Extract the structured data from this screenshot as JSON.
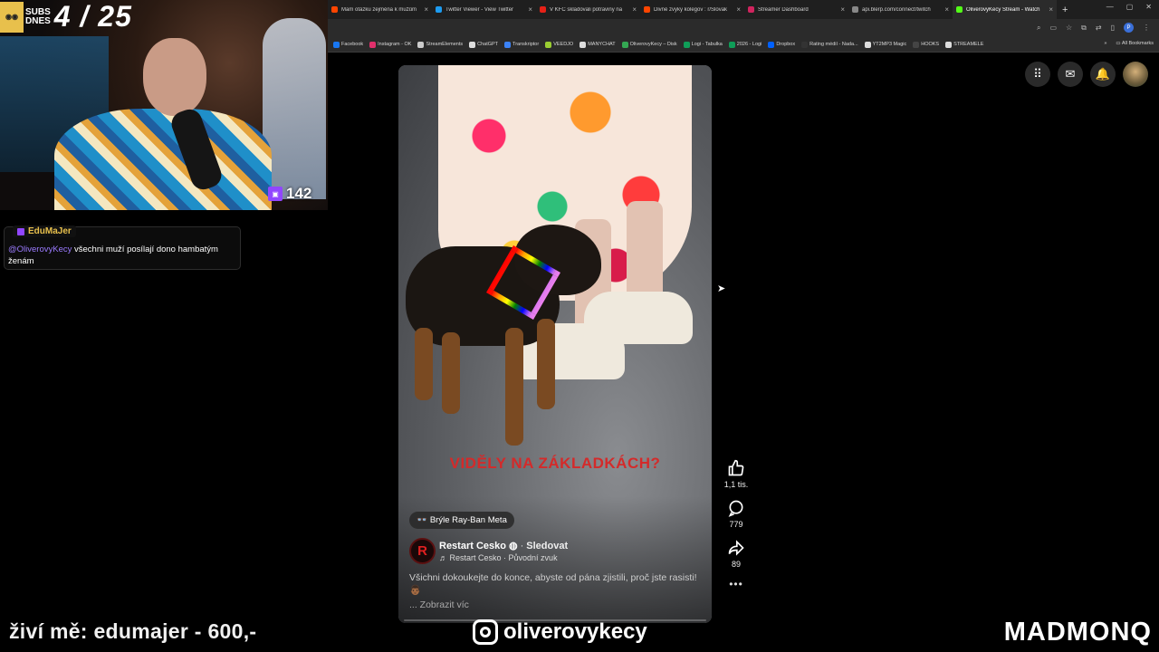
{
  "browser": {
    "tabs": [
      {
        "label": "Mam otázku zejména k mužům",
        "color": "#ff4500",
        "active": false
      },
      {
        "label": "Twitter Viewer - View Twitter",
        "color": "#1d9bf0",
        "active": false
      },
      {
        "label": "V KFC skladovali potraviny na",
        "color": "#e62117",
        "active": false
      },
      {
        "label": "Divné zvyky kolegov : r/Slovak",
        "color": "#ff4500",
        "active": false
      },
      {
        "label": "Streamer Dashboard",
        "color": "#d0245e",
        "active": false
      },
      {
        "label": "api.blerp.com/connect/twitch",
        "color": "#888888",
        "active": false
      },
      {
        "label": "OliverovyKecy Stream - Watch",
        "color": "#53fc18",
        "active": true
      }
    ],
    "new_tab": "+",
    "window_controls": [
      "—",
      "▢",
      "✕"
    ],
    "profile_initial": "P",
    "bookmarks": [
      {
        "label": "Facebook",
        "color": "#1877f2"
      },
      {
        "label": "Instagram - OK",
        "color": "#e1306c"
      },
      {
        "label": "StreamElements",
        "color": "#cccccc"
      },
      {
        "label": "ChatGPT",
        "color": "#dddddd"
      },
      {
        "label": "Transkriptor",
        "color": "#3b82f6"
      },
      {
        "label": "VEEDJO",
        "color": "#9acd32"
      },
      {
        "label": "MANYCHAT",
        "color": "#dddddd"
      },
      {
        "label": "OliverovyKecy – Disk",
        "color": "#34a853"
      },
      {
        "label": "Logi - Tabulka",
        "color": "#0f9d58"
      },
      {
        "label": "2026 - Logi",
        "color": "#0f9d58"
      },
      {
        "label": "Dropbox",
        "color": "#0061ff"
      },
      {
        "label": "Rating médií - Nada...",
        "color": "#333333"
      },
      {
        "label": "YT2MP3 Magic",
        "color": "#dddddd"
      },
      {
        "label": "HOOKS",
        "color": "#444444"
      },
      {
        "label": "STREAMELE",
        "color": "#dddddd"
      }
    ],
    "bookmarks_overflow": "»",
    "all_bookmarks": "All Bookmarks"
  },
  "webcam": {
    "subs_label_1": "SUBS",
    "subs_label_2": "DNES",
    "subs_count": "4 / 25",
    "viewers": "142"
  },
  "chat": {
    "username": "EduMaJer",
    "mention": "@OliverovyKecy",
    "message": " všechni muží posílají dono hambatým ženám"
  },
  "reel": {
    "caption": "VIDĚLY NA ZÁKLADKÁCH?",
    "chip": "Brýle Ray-Ban Meta",
    "author_initial": "R",
    "author": "Restart Cesko",
    "follow": "Sledovat",
    "audio": "Restart Cesko · Původní zvuk",
    "description": "Všichni dokoukejte do konce, abyste od pána zjistili, proč jste rasisti! 👨🏾",
    "more": "... Zobrazit víc",
    "likes": "1,1 tis.",
    "comments": "779",
    "shares": "89",
    "more_actions": "•••"
  },
  "overlay": {
    "donate": "živí mě: edumajer - 600,-",
    "instagram": "oliverovykecy",
    "brand": "MADMONQ"
  }
}
